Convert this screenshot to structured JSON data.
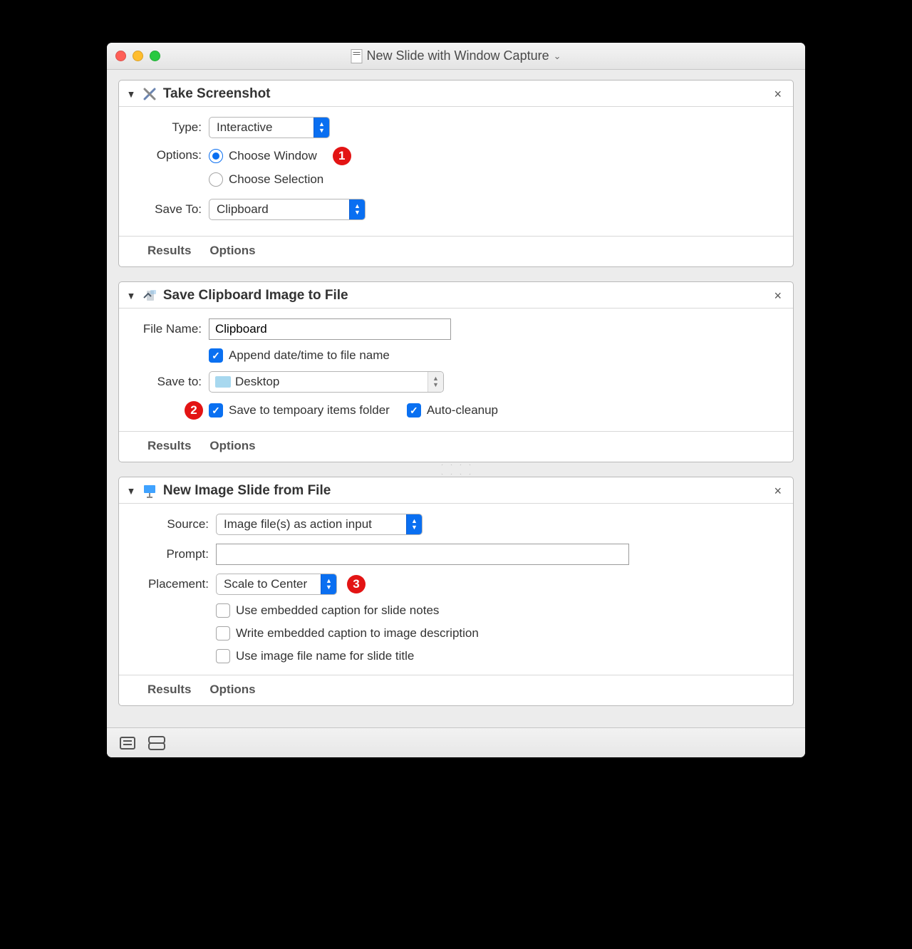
{
  "window_title": "New Slide with Window Capture",
  "cards": {
    "take_screenshot": {
      "title": "Take Screenshot",
      "type_label": "Type:",
      "type_value": "Interactive",
      "options_label": "Options:",
      "radio_choose_window": "Choose Window",
      "radio_choose_selection": "Choose Selection",
      "saveto_label": "Save To:",
      "saveto_value": "Clipboard"
    },
    "save_clipboard": {
      "title": "Save Clipboard Image to File",
      "filename_label": "File Name:",
      "filename_value": "Clipboard",
      "append_date_label": "Append date/time to file name",
      "saveto_label": "Save to:",
      "saveto_value": "Desktop",
      "save_temp_label": "Save to tempoary items folder",
      "auto_cleanup_label": "Auto-cleanup"
    },
    "new_slide": {
      "title": "New Image Slide from File",
      "source_label": "Source:",
      "source_value": "Image file(s) as action input",
      "prompt_label": "Prompt:",
      "prompt_value": "",
      "placement_label": "Placement:",
      "placement_value": "Scale to Center",
      "opt_caption_notes": "Use embedded caption for slide notes",
      "opt_caption_desc": "Write embedded caption to image description",
      "opt_filename_title": "Use image file name for slide title"
    }
  },
  "footer": {
    "results": "Results",
    "options": "Options"
  },
  "badges": {
    "b1": "1",
    "b2": "2",
    "b3": "3"
  }
}
